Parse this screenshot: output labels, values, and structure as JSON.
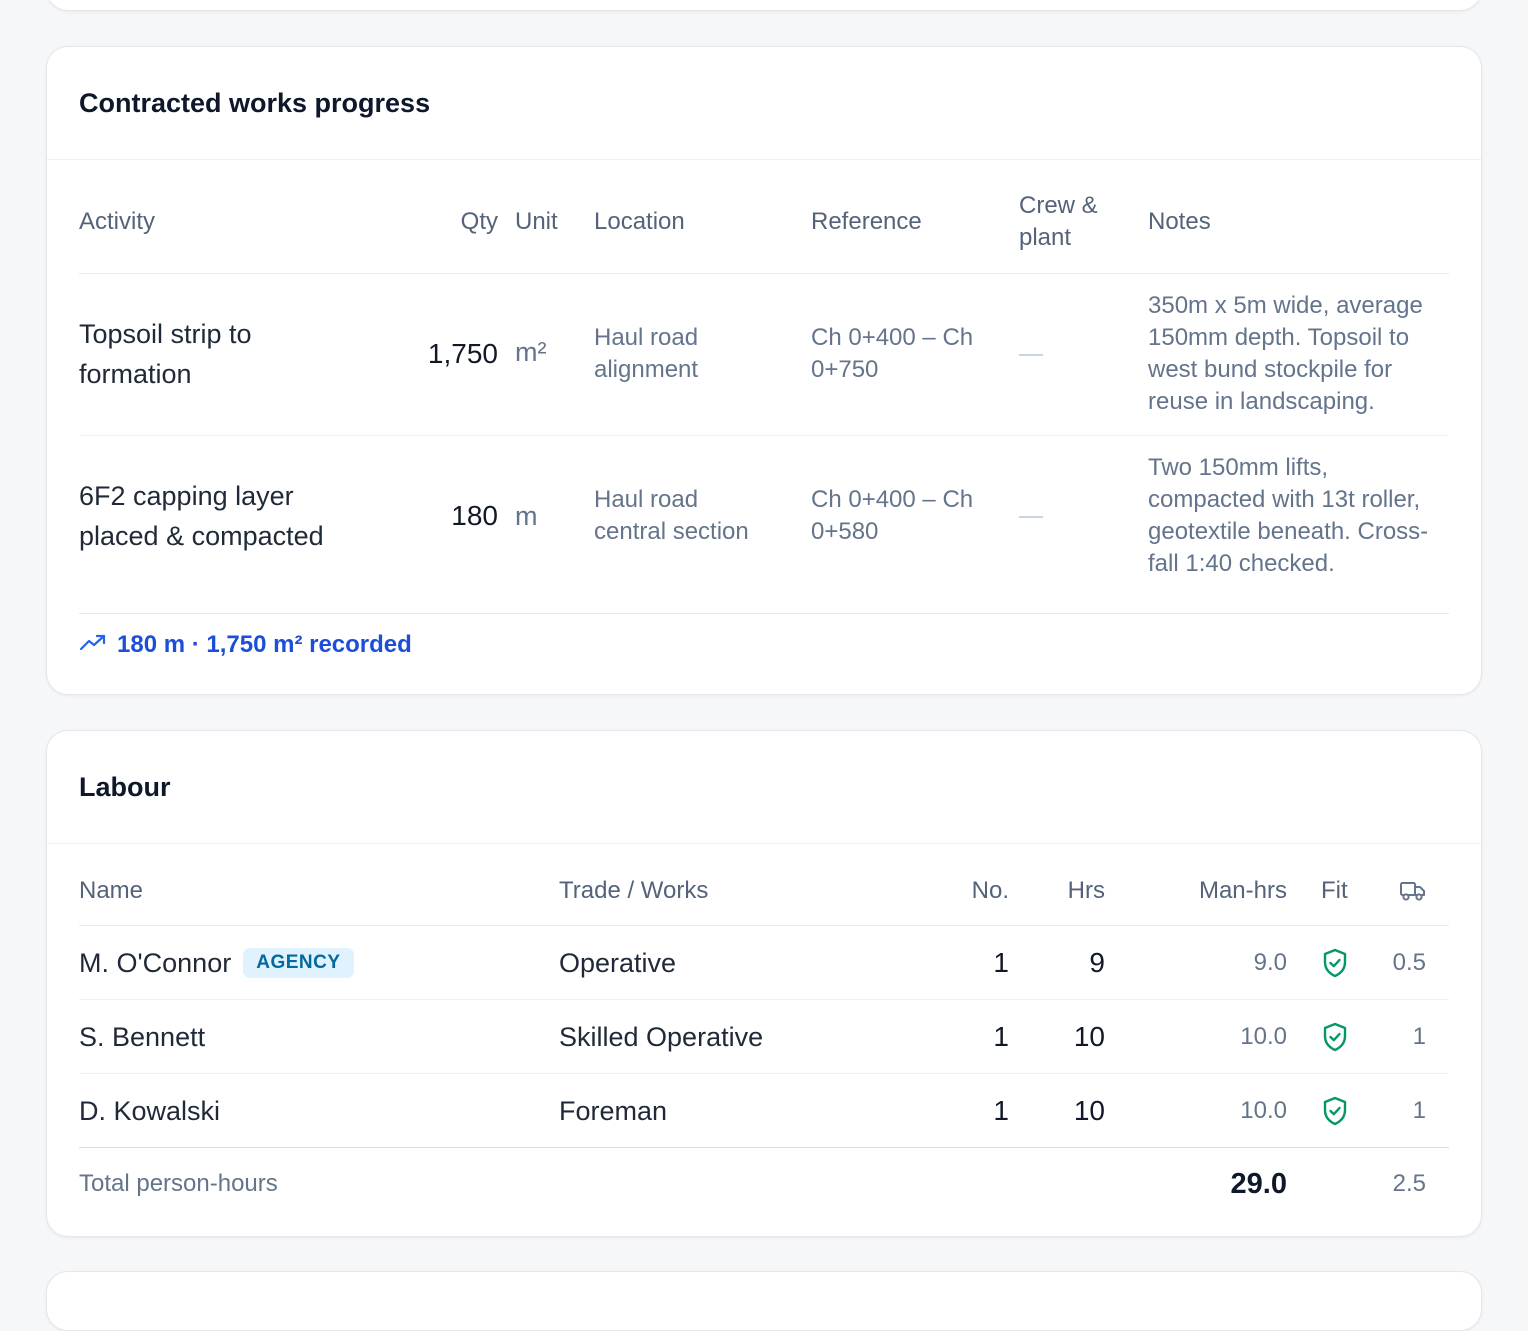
{
  "works": {
    "title": "Contracted works progress",
    "headers": {
      "activity": "Activity",
      "qty": "Qty",
      "unit": "Unit",
      "location": "Location",
      "reference": "Reference",
      "crew_line1": "Crew &",
      "crew_line2": "plant",
      "notes": "Notes"
    },
    "rows": [
      {
        "activity_l1": "Topsoil strip to",
        "activity_l2": "formation",
        "qty": "1,750",
        "unit": "m²",
        "location_l1": "Haul road",
        "location_l2": "alignment",
        "reference_l1": "Ch 0+400 – Ch",
        "reference_l2": "0+750",
        "notes": [
          "350m x 5m wide, average",
          "150mm depth. Topsoil to",
          "west bund stockpile for",
          "reuse in landscaping."
        ]
      },
      {
        "activity_l1": "6F2 capping layer",
        "activity_l2": "placed & compacted",
        "qty": "180",
        "unit": "m",
        "location_l1": "Haul road",
        "location_l2": "central section",
        "reference_l1": "Ch 0+400 – Ch",
        "reference_l2": "0+580",
        "notes": [
          "Two 150mm lifts,",
          "compacted with 13t roller,",
          "geotextile beneath. Cross-",
          "fall 1:40 checked."
        ]
      }
    ],
    "summary": "180 m · 1,750 m² recorded",
    "summary_icon": "trending-up-icon"
  },
  "labour": {
    "title": "Labour",
    "headers": {
      "name": "Name",
      "trade": "Trade / Works",
      "no": "No.",
      "hrs": "Hrs",
      "manhrs": "Man-hrs",
      "fit": "Fit",
      "vehicle_icon": "truck-icon"
    },
    "rows": [
      {
        "name": "M. O'Connor",
        "badge": "AGENCY",
        "trade": "Operative",
        "no": "1",
        "hrs": "9",
        "manhrs": "9.0",
        "fit": "shield-check-icon",
        "vehicle": "0.5"
      },
      {
        "name": "S. Bennett",
        "trade": "Skilled Operative",
        "no": "1",
        "hrs": "10",
        "manhrs": "10.0",
        "fit": "shield-check-icon",
        "vehicle": "1"
      },
      {
        "name": "D. Kowalski",
        "trade": "Foreman",
        "no": "1",
        "hrs": "10",
        "manhrs": "10.0",
        "fit": "shield-check-icon",
        "vehicle": "1"
      }
    ],
    "total_label": "Total person-hours",
    "total_manhrs": "29.0",
    "total_vehicle": "2.5"
  },
  "colors": {
    "accent_blue": "#1d4ed8",
    "fit_green": "#059669",
    "badge_bg": "#e0f2fe",
    "badge_text": "#0369a1"
  }
}
